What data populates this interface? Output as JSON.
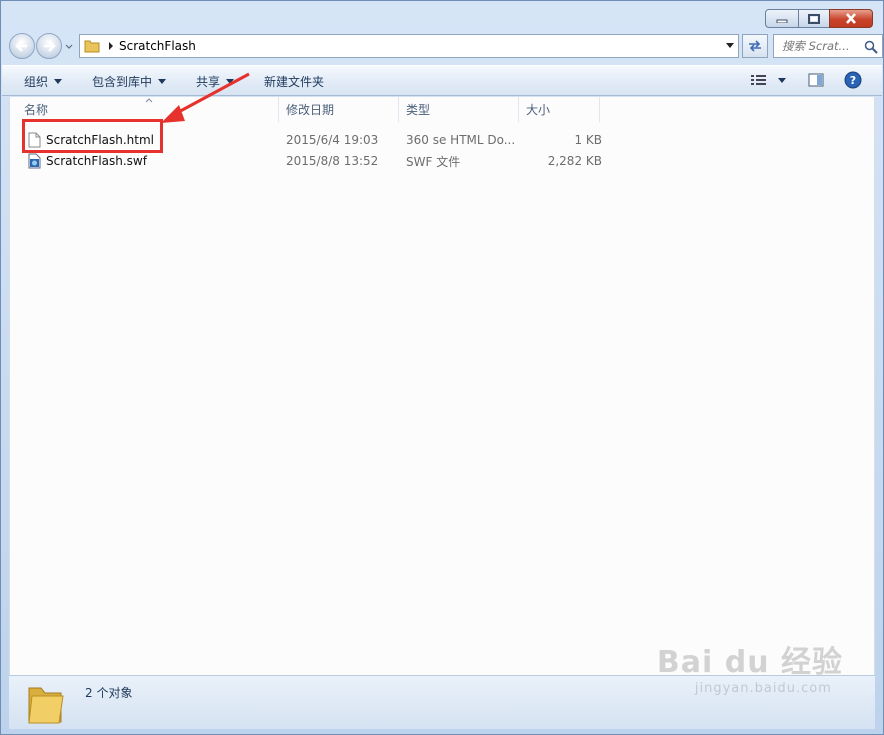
{
  "window": {
    "caption_buttons": {
      "minimize_icon": "minimize-icon",
      "maximize_icon": "maximize-icon",
      "close_icon": "close-icon"
    }
  },
  "address_bar": {
    "path": "ScratchFlash",
    "search_placeholder": "搜索 Scrat..."
  },
  "toolbar": {
    "organize": "组织",
    "include_in_library": "包含到库中",
    "share": "共享",
    "new_folder": "新建文件夹"
  },
  "columns": {
    "name": "名称",
    "date_modified": "修改日期",
    "type": "类型",
    "size": "大小"
  },
  "files": [
    {
      "name": "ScratchFlash.html",
      "date": "2015/6/4 19:03",
      "type": "360 se HTML Do...",
      "size": "1 KB",
      "icon": "html-file-icon"
    },
    {
      "name": "ScratchFlash.swf",
      "date": "2015/8/8 13:52",
      "type": "SWF 文件",
      "size": "2,282 KB",
      "icon": "swf-file-icon"
    }
  ],
  "status_bar": {
    "item_count": "2 个对象"
  },
  "watermark": {
    "brand": "Bai du 经验",
    "url": "jingyan.baidu.com"
  },
  "colors": {
    "highlight": "#e5322d",
    "window_frame": "#bdd2ec",
    "close_button": "#c8452c"
  }
}
